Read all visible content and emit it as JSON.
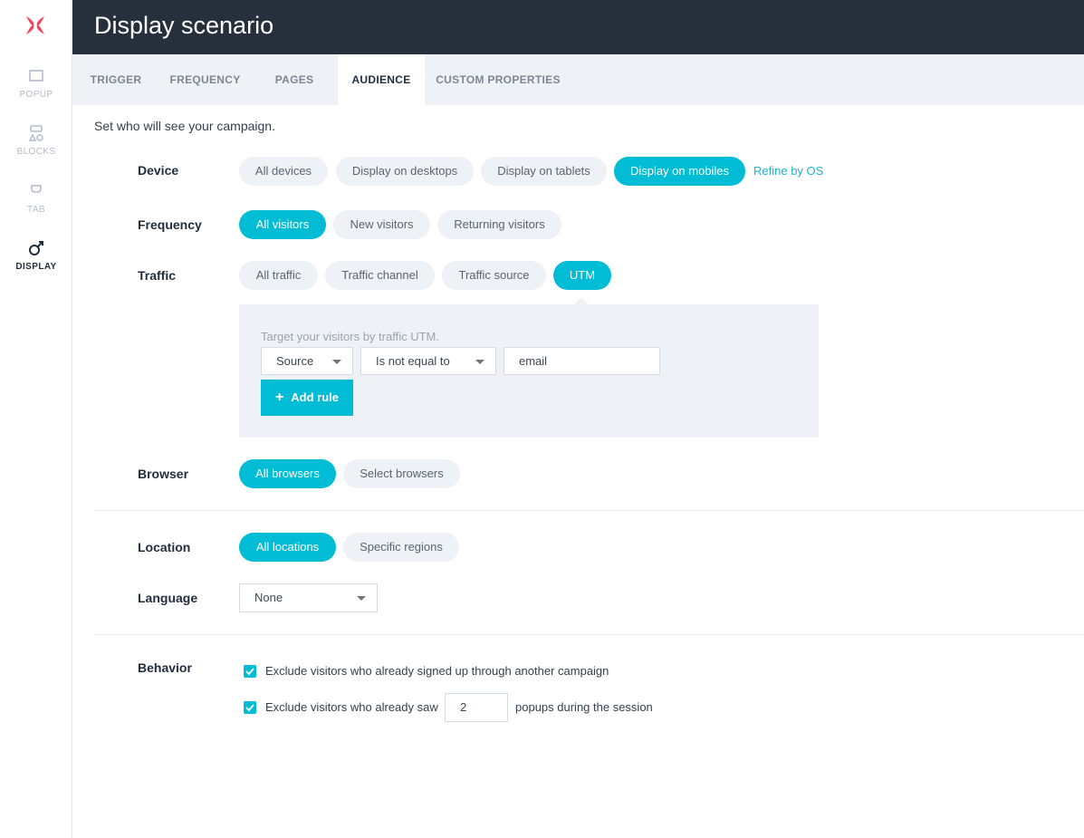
{
  "sidebar": {
    "items": [
      {
        "label": "POPUP",
        "icon": "popup-icon"
      },
      {
        "label": "BLOCKS",
        "icon": "blocks-icon"
      },
      {
        "label": "TAB",
        "icon": "tab-icon"
      },
      {
        "label": "DISPLAY",
        "icon": "display-icon"
      }
    ],
    "active": "DISPLAY",
    "logo_color": "#f0475a"
  },
  "header": {
    "title": "Display scenario"
  },
  "tabs": [
    "TRIGGER",
    "FREQUENCY",
    "PAGES",
    "AUDIENCE",
    "CUSTOM PROPERTIES"
  ],
  "active_tab": "AUDIENCE",
  "intro": "Set who will see your campaign.",
  "device": {
    "label": "Device",
    "options": [
      "All devices",
      "Display on desktops",
      "Display on tablets",
      "Display on mobiles"
    ],
    "selected": "Display on mobiles",
    "refine_link": "Refine by OS"
  },
  "frequency": {
    "label": "Frequency",
    "options": [
      "All visitors",
      "New visitors",
      "Returning visitors"
    ],
    "selected": "All visitors"
  },
  "traffic": {
    "label": "Traffic",
    "options": [
      "All traffic",
      "Traffic channel",
      "Traffic source",
      "UTM"
    ],
    "selected": "UTM",
    "utm": {
      "hint": "Target your visitors by traffic UTM.",
      "field_select": "Source",
      "operator_select": "Is not equal to",
      "value": "email",
      "add_rule": "Add rule"
    }
  },
  "browser": {
    "label": "Browser",
    "options": [
      "All browsers",
      "Select browsers"
    ],
    "selected": "All browsers"
  },
  "location": {
    "label": "Location",
    "options": [
      "All locations",
      "Specific regions"
    ],
    "selected": "All locations"
  },
  "language": {
    "label": "Language",
    "value": "None"
  },
  "behavior": {
    "label": "Behavior",
    "exclude_signed_up": "Exclude visitors who already signed up through another campaign",
    "exclude_saw_prefix": "Exclude visitors who already saw",
    "popup_count": "2",
    "exclude_saw_suffix": "popups during the session"
  },
  "colors": {
    "accent": "#00bcd4",
    "header_bg": "#26303d",
    "link": "#1fb3cc"
  }
}
